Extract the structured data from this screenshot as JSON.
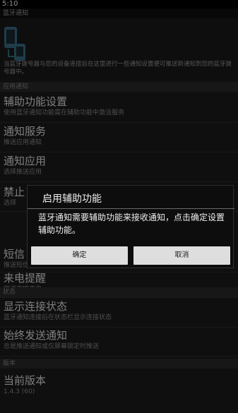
{
  "status_bar": {
    "time": "5:10"
  },
  "app_title": "蓝牙通知",
  "header_description": "当蓝牙拨号器与您的设备连接后在这里进行一些通知设置便可推送新通知到您的蓝牙拨号器中。",
  "categories": {
    "app_notifications": "应用通知",
    "status": "状态",
    "version": "版本"
  },
  "items": [
    {
      "title": "辅助功能设置",
      "subtitle": "使用蓝牙通知功能需在辅助功能中激活服务"
    },
    {
      "title": "通知服务",
      "subtitle": "推送应用通知"
    },
    {
      "title": "通知应用",
      "subtitle": "选择推送应用"
    },
    {
      "title": "禁止",
      "subtitle": "选择"
    },
    {
      "title": "短信",
      "subtitle": "推送短信"
    },
    {
      "title": "来电提醒",
      "subtitle": "推送来接来电"
    },
    {
      "title": "显示连接状态",
      "subtitle": "蓝牙通知连接后在状态栏显示连接状态"
    },
    {
      "title": "始终发送通知",
      "subtitle": "总是推送通知或仅屏幕锁定时推送"
    },
    {
      "title": "当前版本",
      "subtitle": "1.4.3 (60)"
    }
  ],
  "dialog": {
    "title": "启用辅助功能",
    "message": "蓝牙通知需要辅助功能来接收通知，点击确定设置辅助功能。",
    "ok_label": "确定",
    "cancel_label": "取消"
  }
}
